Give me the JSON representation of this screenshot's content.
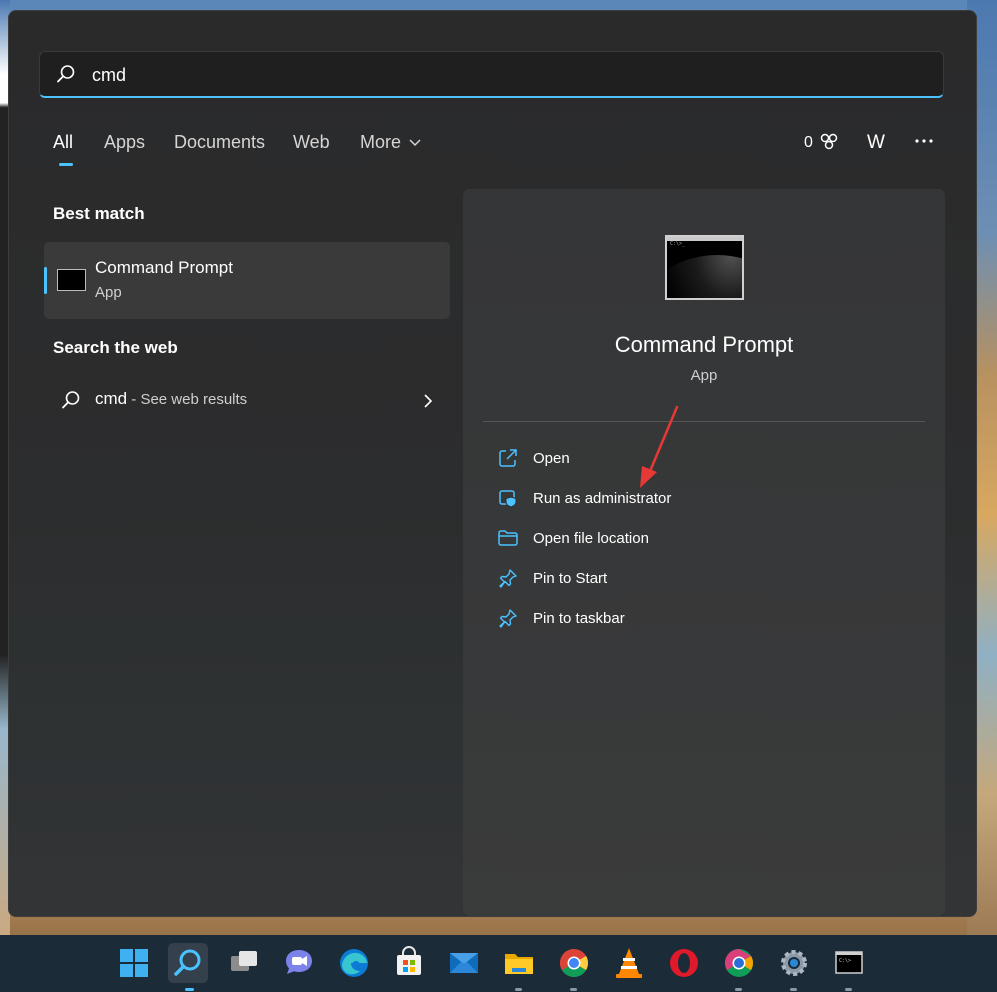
{
  "search": {
    "query": "cmd"
  },
  "tabs": [
    {
      "label": "All",
      "active": true
    },
    {
      "label": "Apps"
    },
    {
      "label": "Documents"
    },
    {
      "label": "Web"
    },
    {
      "label": "More"
    }
  ],
  "header_right": {
    "rewards_points": "0",
    "avatar_initial": "W"
  },
  "results": {
    "best_match_title": "Best match",
    "best_match": {
      "name": "Command Prompt",
      "type": "App"
    },
    "search_web_title": "Search the web",
    "web_query": "cmd",
    "web_suffix": " - See web results"
  },
  "details": {
    "app_name": "Command Prompt",
    "app_type": "App",
    "actions": [
      {
        "label": "Open",
        "icon": "open-external-icon"
      },
      {
        "label": "Run as administrator",
        "icon": "shield-admin-icon"
      },
      {
        "label": "Open file location",
        "icon": "folder-icon"
      },
      {
        "label": "Pin to Start",
        "icon": "pin-icon"
      },
      {
        "label": "Pin to taskbar",
        "icon": "pin-icon"
      }
    ]
  },
  "colors": {
    "accent": "#4cc2ff",
    "panel": "#2b2b2b",
    "annotation_arrow": "#e53935"
  },
  "taskbar": [
    "windows-start-icon",
    "search-icon",
    "task-view-icon",
    "teams-chat-icon",
    "edge-icon",
    "store-icon",
    "mail-icon",
    "file-explorer-icon",
    "chrome-icon",
    "vlc-icon",
    "opera-icon",
    "chrome-canary-icon",
    "settings-icon",
    "terminal-icon"
  ]
}
